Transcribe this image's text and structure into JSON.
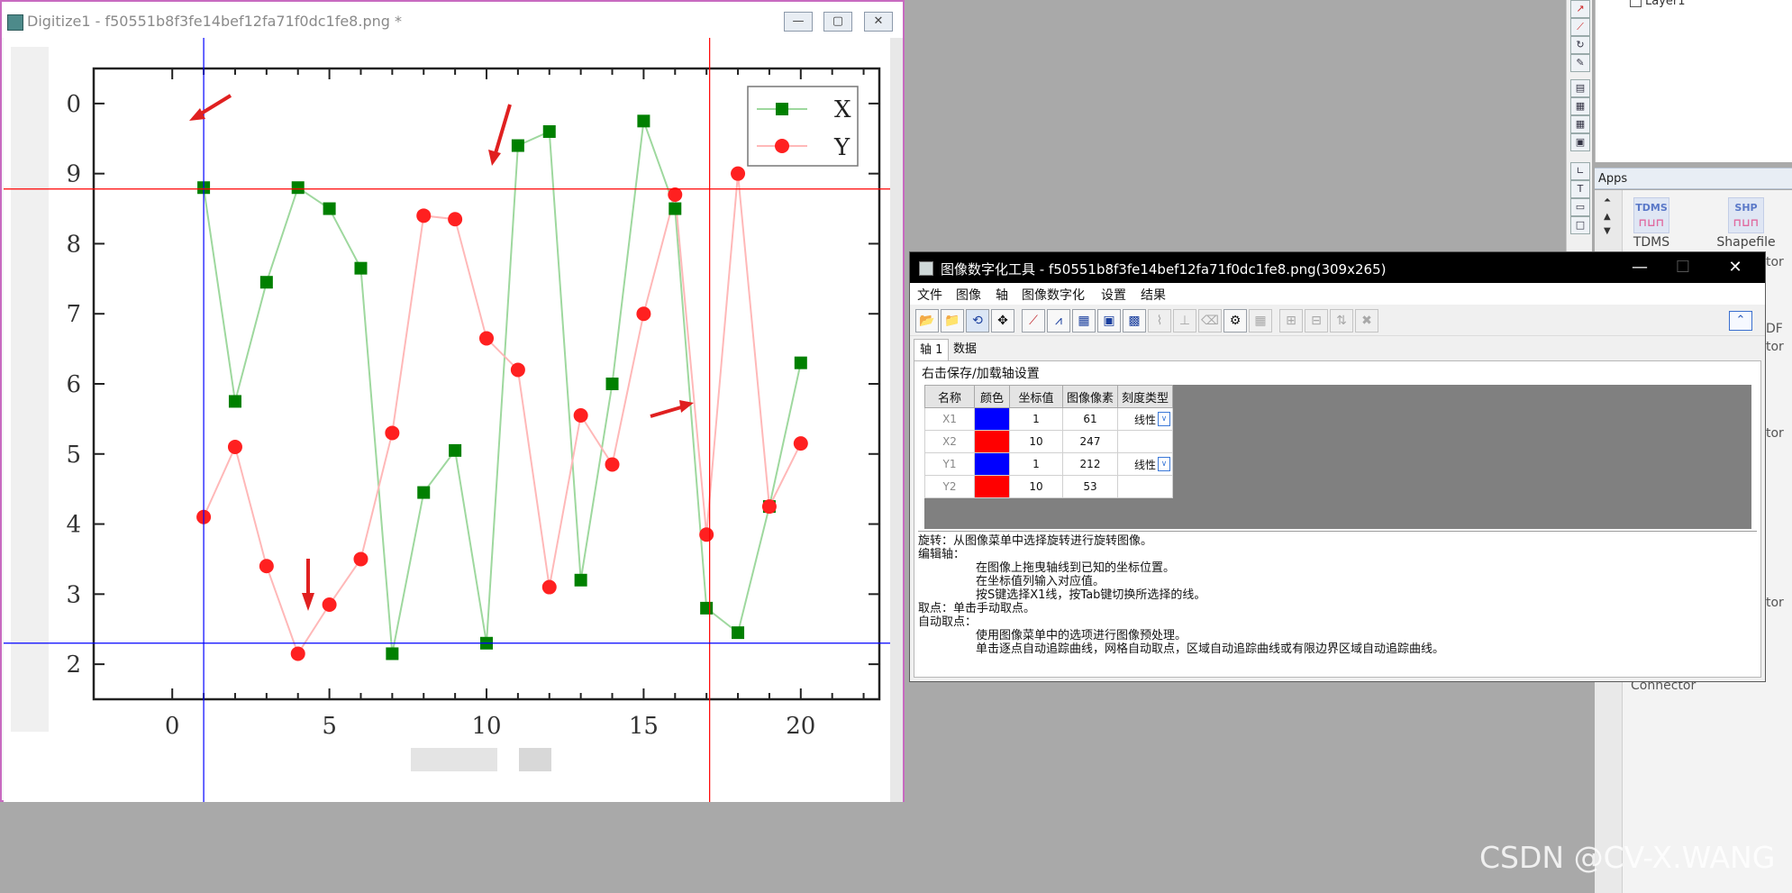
{
  "digitize_window": {
    "title": "Digitize1 - f50551b8f3fe14bef12fa71f0dc1fe8.png *",
    "minimize_glyph": "—",
    "maximize_glyph": "▢",
    "close_glyph": "✕"
  },
  "chart_data": {
    "type": "line",
    "x": [
      1,
      2,
      3,
      4,
      5,
      6,
      7,
      8,
      9,
      10,
      11,
      12,
      13,
      14,
      15,
      16,
      17,
      18,
      19,
      20
    ],
    "series": [
      {
        "name": "X",
        "color": "#008000",
        "marker": "square",
        "values": [
          8.8,
          5.75,
          7.45,
          8.8,
          8.5,
          7.65,
          2.15,
          4.45,
          5.05,
          2.3,
          9.4,
          9.6,
          3.2,
          6.0,
          9.75,
          8.5,
          2.8,
          2.45,
          4.25,
          6.3
        ]
      },
      {
        "name": "Y",
        "color": "#ff2020",
        "marker": "circle",
        "values": [
          4.1,
          5.1,
          3.4,
          2.15,
          2.85,
          3.5,
          5.3,
          8.4,
          8.35,
          6.65,
          6.2,
          3.1,
          5.55,
          4.85,
          7.0,
          8.7,
          3.85,
          9.0,
          4.25,
          5.15
        ]
      }
    ],
    "xticks": [
      "0",
      "5",
      "10",
      "15",
      "20"
    ],
    "yticks": [
      "2",
      "3",
      "4",
      "5",
      "6",
      "7",
      "8",
      "9",
      "0"
    ],
    "xlim": [
      -2.5,
      22.5
    ],
    "ylim": [
      1.5,
      10.5
    ],
    "legend_position": "top-right",
    "overlay_lines": {
      "x1_color": "#0000ff",
      "x2_color": "#ff0000",
      "y1_color": "#0000ff",
      "y2_color": "#ff0000"
    },
    "annotation_color": "#e02020"
  },
  "tool_window": {
    "title": "图像数字化工具 - f50551b8f3fe14bef12fa71f0dc1fe8.png(309x265)",
    "minimize_glyph": "—",
    "maximize_glyph": "☐",
    "close_glyph": "✕",
    "menu": [
      "文件",
      "图像",
      "轴",
      "图像数字化",
      "设置",
      "结果"
    ],
    "tabs": [
      "轴 1",
      "数据"
    ],
    "axis_hint": "右击保存/加载轴设置",
    "axis_table": {
      "headers": [
        "名称",
        "颜色",
        "坐标值",
        "图像像素",
        "刻度类型"
      ],
      "rows": [
        {
          "name": "X1",
          "color": "#0000ff",
          "value": "1",
          "pixel": "61",
          "scale": "线性"
        },
        {
          "name": "X2",
          "color": "#ff0000",
          "value": "10",
          "pixel": "247",
          "scale": ""
        },
        {
          "name": "Y1",
          "color": "#0000ff",
          "value": "1",
          "pixel": "212",
          "scale": "线性"
        },
        {
          "name": "Y2",
          "color": "#ff0000",
          "value": "10",
          "pixel": "53",
          "scale": ""
        }
      ]
    },
    "help_lines": [
      {
        "text": "旋转：从图像菜单中选择旋转进行旋转图像。",
        "indent": false
      },
      {
        "text": "编辑轴：",
        "indent": false
      },
      {
        "text": "在图像上拖曳轴线到已知的坐标位置。",
        "indent": true
      },
      {
        "text": "在坐标值列输入对应值。",
        "indent": true
      },
      {
        "text": "按S键选择X1线，按Tab键切换所选择的线。",
        "indent": true
      },
      {
        "text": "取点：单击手动取点。",
        "indent": false
      },
      {
        "text": "自动取点：",
        "indent": false
      },
      {
        "text": "使用图像菜单中的选项进行图像预处理。",
        "indent": true
      },
      {
        "text": "单击逐点自动追踪曲线，网格自动取点，区域自动追踪曲线或有限边界区域自动追踪曲线。",
        "indent": true
      }
    ]
  },
  "object_manager": {
    "layer_label": "Layer1"
  },
  "apps": {
    "header": "Apps",
    "tiles": [
      {
        "icon_text": "TDMS",
        "label": "TDMS"
      },
      {
        "icon_text": "SHP",
        "label": "Shapefile"
      }
    ],
    "partial_labels": [
      "tor",
      "DF",
      "tor",
      "tor",
      "tor",
      "Connector"
    ]
  },
  "watermark": "CSDN @CV-X.WANG"
}
